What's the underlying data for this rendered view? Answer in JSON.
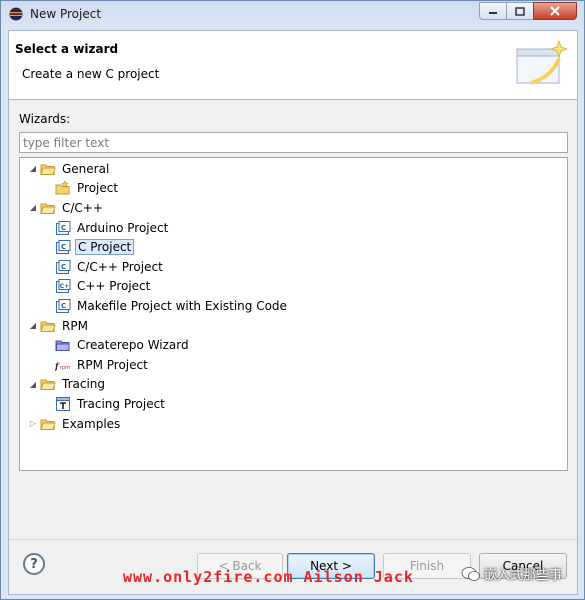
{
  "window": {
    "title": "New Project"
  },
  "header": {
    "title": "Select a wizard",
    "description": "Create a new C project"
  },
  "wizards": {
    "label": "Wizards:",
    "filter_placeholder": "type filter text"
  },
  "tree": {
    "items": [
      {
        "label": "General",
        "icon": "folder-icon",
        "expanded": true
      },
      {
        "label": "Project",
        "icon": "project-icon"
      },
      {
        "label": "C/C++",
        "icon": "folder-icon",
        "expanded": true
      },
      {
        "label": "Arduino Project",
        "icon": "c-file-icon"
      },
      {
        "label": "C Project",
        "icon": "c-file-icon",
        "selected": true
      },
      {
        "label": "C/C++ Project",
        "icon": "c-file-icon"
      },
      {
        "label": "C++ Project",
        "icon": "cpp-file-icon"
      },
      {
        "label": "Makefile Project with Existing Code",
        "icon": "c-file-icon"
      },
      {
        "label": "RPM",
        "icon": "folder-icon",
        "expanded": true
      },
      {
        "label": "Createrepo Wizard",
        "icon": "repo-icon"
      },
      {
        "label": "RPM Project",
        "icon": "rpm-icon"
      },
      {
        "label": "Tracing",
        "icon": "folder-icon",
        "expanded": true
      },
      {
        "label": "Tracing Project",
        "icon": "tracing-icon"
      },
      {
        "label": "Examples",
        "icon": "folder-icon",
        "expanded": false
      }
    ]
  },
  "buttons": {
    "back": "< Back",
    "next": "Next >",
    "finish": "Finish",
    "cancel": "Cancel"
  },
  "watermark": {
    "text": "www.only2fire.com Ailson Jack",
    "wechat": "嵌入式那些事"
  },
  "colors": {
    "selection": "#dcebfc",
    "watermark": "#e3262a"
  }
}
